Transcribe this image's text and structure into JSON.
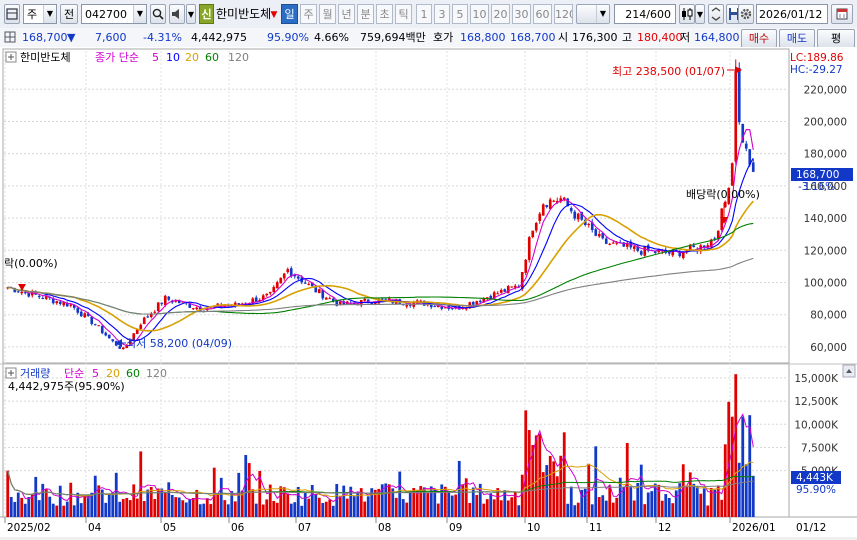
{
  "toolbar": {
    "market_select": "주",
    "prev_button": "전",
    "code_input": "042700",
    "stock_badge": "신",
    "stock_name": "한미반도체",
    "periods": [
      {
        "label": "일",
        "active": true
      },
      {
        "label": "주",
        "active": false
      },
      {
        "label": "월",
        "active": false
      },
      {
        "label": "년",
        "active": false
      },
      {
        "label": "분",
        "active": false
      },
      {
        "label": "초",
        "active": false
      },
      {
        "label": "틱",
        "active": false
      }
    ],
    "intervals": [
      "1",
      "3",
      "5",
      "10",
      "20",
      "30",
      "60",
      "120"
    ],
    "count": "214",
    "count_total": "/600",
    "date": "2026/01/12"
  },
  "infobar": {
    "price": "168,700",
    "arrow": "▼",
    "change": "7,600",
    "change_pct": "-4.31%",
    "volume": "4,442,975",
    "volume_ratio": "95.90%",
    "turnover_ratio": "4.66%",
    "trade_value": "759,694백만",
    "quote_label": "호가",
    "ask": "168,800",
    "bid": "168,700",
    "open_label": "시",
    "open": "176,300",
    "high_label": "고",
    "high": "180,400",
    "low_label": "저",
    "low": "164,800",
    "buy_button": "매수",
    "sell_button": "매도",
    "eval_button": "평"
  },
  "price_pane": {
    "stock": "한미반도체",
    "legend_prefix": "종가 단순",
    "ma_periods": [
      "5",
      "10",
      "20",
      "60",
      "120"
    ],
    "ma_colors": [
      "#d000d0",
      "#0000ff",
      "#d8a000",
      "#008000",
      "#808080"
    ],
    "lc": "LC:189.86",
    "hc": "HC:-29.27",
    "last_price": "168,700",
    "last_change": "-3.16%",
    "high_annotation": "최고 238,500 (01/07)",
    "low_annotation": "최저 58,200 (04/09)",
    "dividend_right": "배당락(0.00%)",
    "dividend_left": "락(0.00%)",
    "y_ticks": [
      "220,000",
      "200,000",
      "180,000",
      "160,000",
      "140,000",
      "120,000",
      "100,000",
      "80,000",
      "60,000"
    ]
  },
  "volume_pane": {
    "legend_label": "거래량",
    "legend_prefix": "단순",
    "ma_periods": [
      "5",
      "20",
      "60",
      "120"
    ],
    "ma_colors": [
      "#d000d0",
      "#d8a000",
      "#008000",
      "#808080"
    ],
    "volume_text": "4,442,975주(95.90%)",
    "last_volume": "4,443K",
    "last_ratio": "95.90%",
    "y_ticks": [
      "15,000K",
      "12,500K",
      "10,000K",
      "7,500K",
      "5,000K"
    ]
  },
  "x_axis": {
    "labels": [
      "2025/02",
      "04",
      "05",
      "06",
      "07",
      "08",
      "09",
      "10",
      "11",
      "12",
      "2026/01"
    ],
    "right_label": "01/12"
  },
  "chart_data": [
    {
      "type": "candlestick",
      "title": "한미반도체",
      "x": [
        "2025/02",
        "2025/03",
        "2025/04",
        "2025/05",
        "2025/06",
        "2025/07",
        "2025/08",
        "2025/09",
        "2025/10",
        "2025/11",
        "2025/12",
        "2026/01"
      ],
      "close_approx": [
        95000,
        85000,
        68000,
        90000,
        88000,
        95000,
        87000,
        85000,
        148000,
        128000,
        118000,
        168700
      ],
      "ylim": [
        50000,
        245000
      ],
      "high": {
        "value": 238500,
        "date": "01/07"
      },
      "low": {
        "value": 58200,
        "date": "04/09"
      },
      "last": 168700,
      "moving_averages": [
        5,
        10,
        20,
        60,
        120
      ]
    },
    {
      "type": "bar",
      "title": "거래량",
      "x": [
        "2025/02",
        "2025/03",
        "2025/04",
        "2025/05",
        "2025/06",
        "2025/07",
        "2025/08",
        "2025/09",
        "2025/10",
        "2025/11",
        "2025/12",
        "2026/01"
      ],
      "volume_k_approx": [
        2500,
        3000,
        4500,
        3000,
        2500,
        3500,
        2000,
        2000,
        7000,
        3500,
        2000,
        9000
      ],
      "ylim": [
        0,
        16500
      ],
      "last": 4443,
      "moving_averages": [
        5,
        20,
        60,
        120
      ]
    }
  ]
}
